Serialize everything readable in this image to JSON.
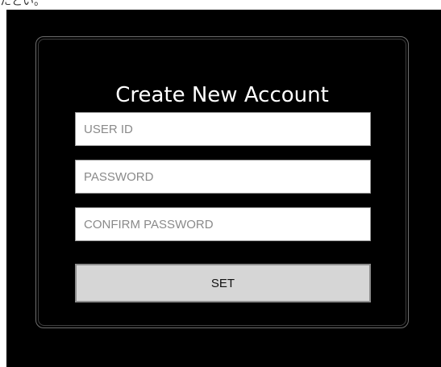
{
  "page_header_fragment": "たとい。",
  "form": {
    "title": "Create New Account",
    "fields": {
      "user_id": {
        "placeholder": "USER ID",
        "value": ""
      },
      "password": {
        "placeholder": "PASSWORD",
        "value": ""
      },
      "confirm_password": {
        "placeholder": "CONFIRM PASSWORD",
        "value": ""
      }
    },
    "submit_label": "SET"
  },
  "colors": {
    "page_background": "#ffffff",
    "screen_background": "#000000",
    "panel_border": "#6f6f6f",
    "field_background": "#ffffff",
    "placeholder_text": "#8a8a8a",
    "button_background": "#d6d6d6",
    "button_border": "#8d8d8d",
    "title_text": "#ffffff"
  }
}
